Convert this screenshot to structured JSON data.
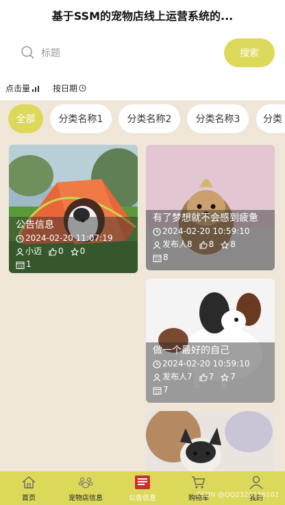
{
  "header": {
    "title": "基于SSM的宠物店线上运营系统的..."
  },
  "search": {
    "placeholder": "标题",
    "button_label": "搜索"
  },
  "sort": {
    "by_clicks": "点击量",
    "by_date": "按日期"
  },
  "categories": [
    "全部",
    "分类名称1",
    "分类名称2",
    "分类名称3",
    "分类"
  ],
  "posts": [
    {
      "title": "公告信息",
      "date": "2024-02-20 11:07:19",
      "author": "小迈",
      "likes": "0",
      "favorites": "0",
      "clicks": "1"
    },
    {
      "title": "有了梦想就不会感到疲惫",
      "date": "2024-02-20 10:59:10",
      "author": "发布人8",
      "likes": "8",
      "favorites": "8",
      "clicks": "8"
    },
    {
      "title": "做一个最好的自己",
      "date": "2024-02-20 10:59:10",
      "author": "发布人7",
      "likes": "7",
      "favorites": "7",
      "clicks": "7"
    }
  ],
  "nav": [
    {
      "label": "首页",
      "icon": "home-icon"
    },
    {
      "label": "宠物店信息",
      "icon": "paw-icon"
    },
    {
      "label": "公告信息",
      "icon": "notice-icon"
    },
    {
      "label": "购物车",
      "icon": "cart-icon"
    },
    {
      "label": "我的",
      "icon": "user-icon"
    }
  ],
  "watermark": "CSDN @QQ2320136102",
  "colors": {
    "accent": "#dcd85a",
    "background": "#efe6d8"
  }
}
